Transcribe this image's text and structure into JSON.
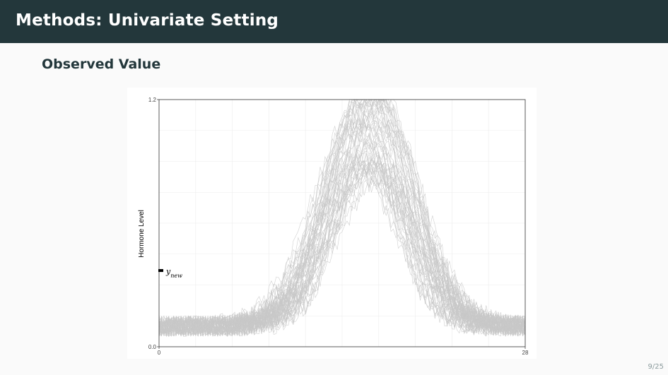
{
  "slide": {
    "title": "Methods: Univariate Setting",
    "subtitle": "Observed Value",
    "page_number": "9/25"
  },
  "colors": {
    "title_bar": "#23373b",
    "background": "#fafafa",
    "curve_color": "#c8c8c8",
    "marker_color": "#000000"
  },
  "chart_data": {
    "type": "line",
    "ylabel": "Hormone Level",
    "xlabel": "",
    "xlim": [
      0,
      28
    ],
    "ylim": [
      0,
      1.2
    ],
    "x_ticks": [
      "0",
      "28"
    ],
    "y_ticks": [
      "0.0",
      "1.2"
    ],
    "grid": true,
    "series_count": 60,
    "peak_day": 16,
    "peak_level_range": [
      0.65,
      1.2
    ],
    "baseline_level": 0.1,
    "annotation": {
      "label": "y_new",
      "y": 0.37
    }
  }
}
